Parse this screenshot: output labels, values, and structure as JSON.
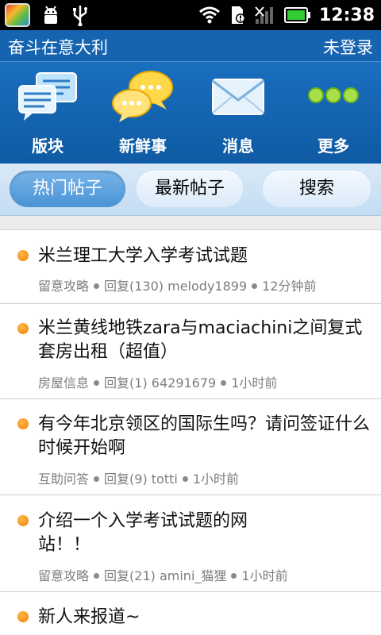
{
  "status_bar": {
    "time": "12:38",
    "left_icons": [
      "app-badge-icon",
      "android-debug-icon",
      "usb-icon"
    ],
    "right_icons": [
      "wifi-icon",
      "sd-card-warning-icon",
      "signal-icon",
      "battery-icon"
    ]
  },
  "header": {
    "title": "奋斗在意大利",
    "login": "未登录"
  },
  "nav": [
    {
      "label": "版块",
      "icon": "board-list-icon"
    },
    {
      "label": "新鲜事",
      "icon": "chat-bubbles-icon"
    },
    {
      "label": "消息",
      "icon": "envelope-icon"
    },
    {
      "label": "更多",
      "icon": "more-dots-icon"
    }
  ],
  "tabs": [
    {
      "label": "热门帖子",
      "active": true
    },
    {
      "label": "最新帖子",
      "active": false
    },
    {
      "label": "搜索",
      "active": false
    }
  ],
  "posts": [
    {
      "title": "米兰理工大学入学考试试题",
      "category": "留意攻略",
      "replies": "回复(130)",
      "author": "melody1899",
      "time": "12分钟前"
    },
    {
      "title": "米兰黄线地铁zara与maciachini之间复式套房出租（超值）",
      "category": "房屋信息",
      "replies": "回复(1)",
      "author": "64291679",
      "time": "1小时前"
    },
    {
      "title": "有今年北京领区的国际生吗？请问签证什么时候开始啊",
      "category": "互助问答",
      "replies": "回复(9)",
      "author": "totti",
      "time": "1小时前"
    },
    {
      "title": "介绍一个入学考试试题的网站！！",
      "category": "留意攻略",
      "replies": "回复(21)",
      "author": "amini_猫狸",
      "time": "1小时前"
    },
    {
      "title": "新人来报道~",
      "category": "",
      "replies": "",
      "author": "",
      "time": ""
    }
  ],
  "colors": {
    "header_blue": "#1664b0",
    "tab_active": "#4a93d6",
    "bullet_orange": "#f08000"
  }
}
